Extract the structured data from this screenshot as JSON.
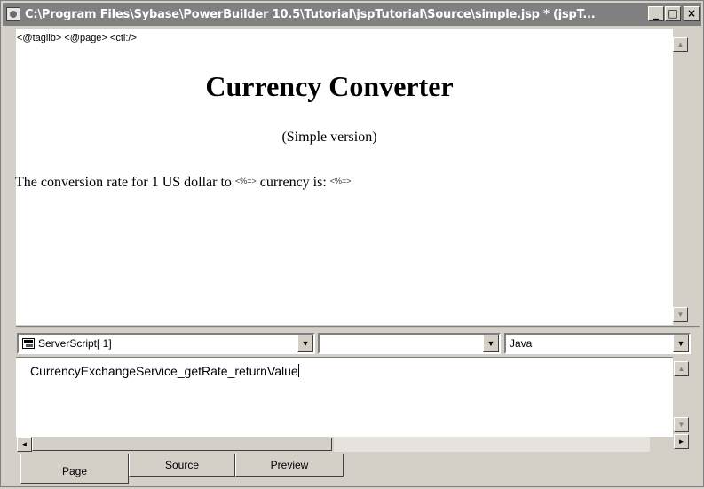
{
  "window": {
    "title": "C:\\Program Files\\Sybase\\PowerBuilder 10.5\\Tutorial\\jspTutorial\\Source\\simple.jsp * (jspT...",
    "buttons": {
      "minimize": "_",
      "maximize": "□",
      "close": "×"
    }
  },
  "design": {
    "tags": "<@taglib> <@page> <ctl:/>",
    "heading": "Currency Converter",
    "subtitle": "(Simple version)",
    "rate_prefix": "The conversion rate for 1 US dollar to",
    "expr1": "<%=>",
    "rate_middle": "currency is:",
    "expr2": "<%=>"
  },
  "script_toolbar": {
    "object": "ServerScript[ 1]",
    "event": "",
    "language": "Java"
  },
  "script_editor": {
    "text": "CurrencyExchangeService_getRate_returnValue"
  },
  "tabs": [
    {
      "label": "Page",
      "active": true
    },
    {
      "label": "Source",
      "active": false
    },
    {
      "label": "Preview",
      "active": false
    }
  ],
  "icons": {
    "app": "powerbuilder-app-icon",
    "scroll_up": "▲",
    "scroll_down": "▼",
    "scroll_left": "◄",
    "scroll_right": "►",
    "dropdown": "▼"
  },
  "colors": {
    "titlebar": "#808080",
    "face": "#d4d0c8"
  }
}
